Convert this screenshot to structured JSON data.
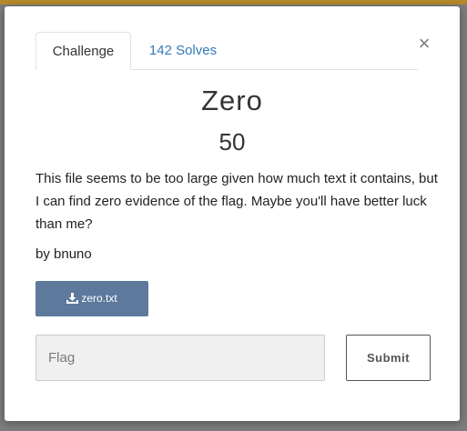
{
  "tabs": [
    {
      "label": "Challenge",
      "active": true
    },
    {
      "label": "142 Solves",
      "active": false
    }
  ],
  "close_glyph": "×",
  "challenge": {
    "name": "Zero",
    "value": "50",
    "description": "This file seems to be too large given how much text it contains, but I can find zero evidence of the flag. Maybe you'll have better luck than me?",
    "author": "by bnuno",
    "file": {
      "label": "zero.txt",
      "icon": "download-icon"
    }
  },
  "form": {
    "flag_placeholder": "Flag",
    "submit_label": "Submit"
  },
  "colors": {
    "accent_bar": "#b58a2c",
    "file_button": "#5d7a9c",
    "tab_link": "#337ab7"
  }
}
